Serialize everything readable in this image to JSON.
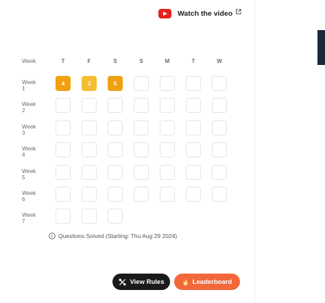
{
  "watch_video": {
    "label": "Watch the video",
    "icon": "youtube-icon",
    "link_icon": "external-link-icon"
  },
  "calendar": {
    "header_label": "Week",
    "days": [
      "T",
      "F",
      "S",
      "S",
      "M",
      "T",
      "W"
    ],
    "weeks": [
      {
        "label": "Week 1",
        "cells": [
          "4",
          "3",
          "5",
          "",
          "",
          "",
          ""
        ]
      },
      {
        "label": "Week 2",
        "cells": [
          "",
          "",
          "",
          "",
          "",
          "",
          ""
        ]
      },
      {
        "label": "Week 3",
        "cells": [
          "",
          "",
          "",
          "",
          "",
          "",
          ""
        ]
      },
      {
        "label": "Week 4",
        "cells": [
          "",
          "",
          "",
          "",
          "",
          "",
          ""
        ]
      },
      {
        "label": "Week 5",
        "cells": [
          "",
          "",
          "",
          "",
          "",
          "",
          ""
        ]
      },
      {
        "label": "Week 6",
        "cells": [
          "",
          "",
          "",
          "",
          "",
          "",
          ""
        ]
      },
      {
        "label": "Week 7",
        "cells": [
          "",
          "",
          ""
        ]
      }
    ],
    "fill_colors": {
      "4": "#f0a10f",
      "3": "#f4bd32",
      "5": "#f0a10f"
    }
  },
  "info": {
    "text": "Questions Solved (Starting: Thu Aug 29 2024)",
    "icon": "info-icon"
  },
  "buttons": {
    "view_rules": {
      "label": "View Rules",
      "icon": "rules-icon",
      "color": "#1a1a1a"
    },
    "leaderboard": {
      "label": "Leaderboard",
      "icon": "fire-icon",
      "color": "#f2683a"
    }
  }
}
